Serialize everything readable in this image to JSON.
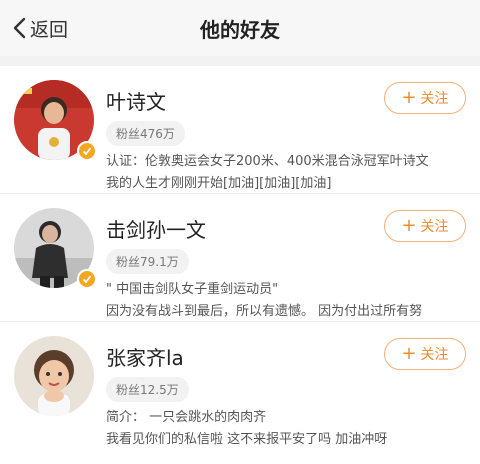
{
  "header": {
    "back_label": "返回",
    "title": "他的好友"
  },
  "friends": [
    {
      "name": "叶诗文",
      "fans": "粉丝476万",
      "line1": "认证：伦敦奥运会女子200米、400米混合泳冠军叶诗文",
      "line2": "我的人生才刚刚开始[加油][加油][加油]",
      "follow_label": "关注"
    },
    {
      "name": "击剑孙一文",
      "fans": "粉丝79.1万",
      "line1": "\" 中国击剑队女子重剑运动员\"",
      "line2": "因为没有战斗到最后，所以有遗憾。 因为付出过所有努",
      "follow_label": "关注"
    },
    {
      "name": "张家齐la",
      "fans": "粉丝12.5万",
      "line1": "简介： 一只会跳水的肉肉齐",
      "line2": "我看见你们的私信啦 这不来报平安了吗 加油冲呀",
      "follow_label": "关注"
    }
  ],
  "colors": {
    "accent": "#f08c2a",
    "badge": "#f5a623"
  },
  "icons": {
    "back": "chevron-left-icon",
    "verified": "verified-badge-icon",
    "plus": "plus-icon"
  }
}
